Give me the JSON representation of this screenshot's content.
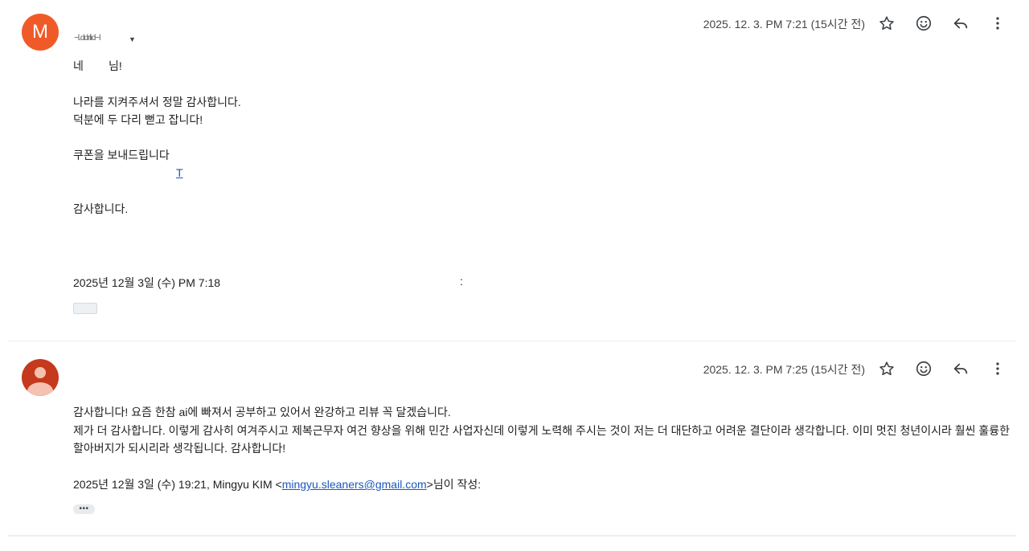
{
  "messages": [
    {
      "avatar_letter": "M",
      "avatar_color": "#f05a28",
      "sender_name": "~l.ddrlid~l",
      "timestamp": "2025. 12. 3. PM 7:21 (15시간 전)",
      "body_text": "네        님!\n\n나라를 지켜주셔서 정말 감사합니다.\n덕분에 두 다리 뻗고 잡니다!\n\n쿠폰을 보내드립니다\n\n\n감사합니다.",
      "link_mark": "T",
      "quote_line": "2025년 12월 3일 (수) PM 7:18",
      "quote_tail": ":",
      "actions": [
        "star-icon",
        "emoji-icon",
        "reply-icon",
        "more-icon"
      ]
    },
    {
      "avatar_color": "#c5391c",
      "timestamp": "2025. 12. 3. PM 7:25 (15시간 전)",
      "body_text": "감사합니다! 요즘 한참 ai에 빠져서 공부하고 있어서 완강하고 리뷰 꼭 달겠습니다.\n제가 더 감사합니다. 이렇게 감사히 여겨주시고 제복근무자 여건 향상을 위해 민간 사업자신데 이렇게 노력해 주시는 것이 저는 더 대단하고 어려운 결단이라 생각합니다. 이미 멋진 청년이시라 훨씬 훌륭한\n할아버지가 되시리라 생각됩니다. 감사합니다!",
      "quote_prefix": "2025년 12월 3일 (수) 19:21, Mingyu KIM <",
      "quote_email": "mingyu.sleaners@gmail.com",
      "quote_suffix": ">님이 작성:",
      "dots": "•••",
      "actions": [
        "star-icon",
        "emoji-icon",
        "reply-icon",
        "more-icon"
      ]
    }
  ],
  "colors": {
    "accent_link": "#1a57c2",
    "divider": "#eceff1"
  }
}
